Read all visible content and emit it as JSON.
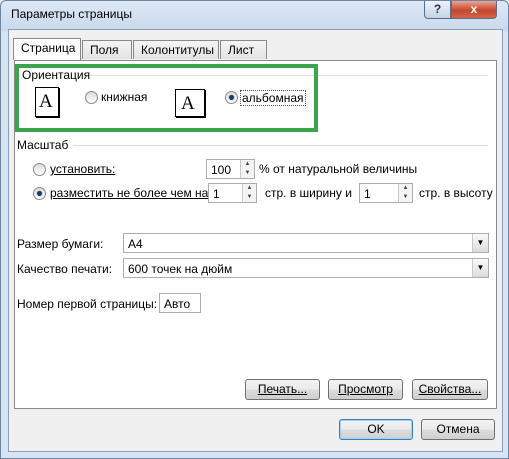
{
  "window": {
    "title": "Параметры страницы",
    "help_glyph": "?",
    "close_glyph": "x"
  },
  "tabs": [
    {
      "label": "Страница",
      "active": true
    },
    {
      "label": "Поля",
      "active": false
    },
    {
      "label": "Колонтитулы",
      "active": false
    },
    {
      "label": "Лист",
      "active": false
    }
  ],
  "orientation": {
    "group_label": "Ориентация",
    "icon_letter": "A",
    "portrait": {
      "label": "книжная",
      "selected": false
    },
    "landscape": {
      "label": "альбомная",
      "selected": true
    }
  },
  "scale": {
    "group_label": "Масштаб",
    "set": {
      "label": "установить:",
      "selected": false,
      "value": "100",
      "suffix": "% от натуральной величины"
    },
    "fit": {
      "label": "разместить не более чем на:",
      "selected": true,
      "width_value": "1",
      "width_suffix": "стр. в ширину и",
      "height_value": "1",
      "height_suffix": "стр. в высоту"
    }
  },
  "paper_size": {
    "label": "Размер бумаги:",
    "value": "A4"
  },
  "print_quality": {
    "label": "Качество печати:",
    "value": "600 точек на дюйм"
  },
  "first_page_number": {
    "label": "Номер первой страницы:",
    "value": "Авто"
  },
  "buttons": {
    "print": "Печать...",
    "preview": "Просмотр",
    "properties": "Свойства...",
    "ok": "OK",
    "cancel": "Отмена"
  },
  "highlight_color": "#3aa54a"
}
